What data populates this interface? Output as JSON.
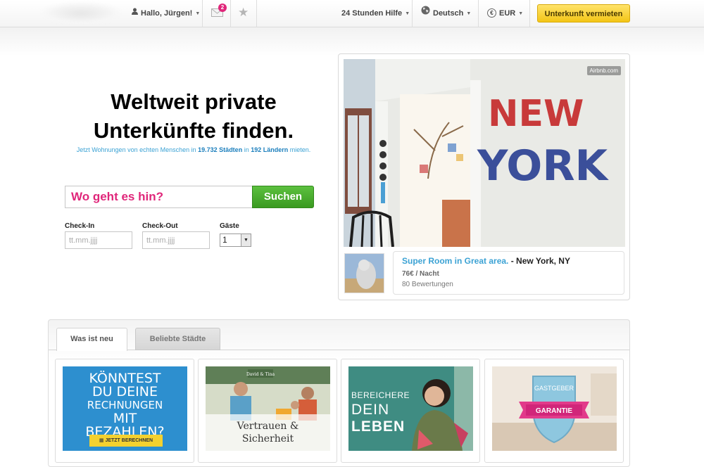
{
  "topbar": {
    "greeting": "Hallo, Jürgen!",
    "messages_count": "2",
    "help_label": "24 Stunden Hilfe",
    "language_label": "Deutsch",
    "currency_label": "EUR",
    "currency_symbol": "€",
    "host_button_label": "Unterkunft vermieten",
    "icons": [
      "user-icon",
      "envelope-icon",
      "star-icon",
      "globe-icon",
      "euro-icon"
    ]
  },
  "hero": {
    "headline_line1": "Weltweit private",
    "headline_line2": "Unterkünfte finden.",
    "subline_pre": "Jetzt Wohnungen von echten Menschen in",
    "subline_cities": "19.732 Städten",
    "subline_mid": "in",
    "subline_countries": "192 Ländern",
    "subline_post": "mieten."
  },
  "search": {
    "placeholder": "Wo geht es hin?",
    "button_label": "Suchen",
    "checkin_label": "Check-In",
    "checkin_placeholder": "tt.mm.jjjj",
    "checkout_label": "Check-Out",
    "checkout_placeholder": "tt.mm.jjjj",
    "guests_label": "Gäste",
    "guests_value": "1"
  },
  "featured": {
    "watermark": "Airbnb.com",
    "wall_text_line1": "NEW",
    "wall_text_line2": "YORK",
    "listing_title": "Super Room in Great area.",
    "listing_location": " - New York, NY",
    "listing_price": "76€ / Nacht",
    "listing_reviews": "80 Bewertungen"
  },
  "tabs": [
    {
      "label": "Was ist neu",
      "active": true
    },
    {
      "label": "Beliebte Städte",
      "active": false
    }
  ],
  "promos": {
    "promo1_lines": [
      "KÖNNTEST",
      "DU DEINE",
      "RECHNUNGEN",
      "MIT",
      "BEZAHLEN?"
    ],
    "promo1_cta": "JETZT BERECHNEN",
    "promo2_sign": "David & Tina",
    "promo2_caption_line1": "Vertrauen &",
    "promo2_caption_line2": "Sicherheit",
    "promo3_small": "BEREICHERE",
    "promo3_line1": "DEIN",
    "promo3_line2": "LEBEN",
    "promo4_line1": "GASTGEBER",
    "promo4_line2": "GARANTIE"
  },
  "colors": {
    "accent_pink": "#e0267a",
    "link_blue": "#3ba2d4",
    "search_green": "#3a9a20",
    "host_yellow": "#f3c516"
  }
}
